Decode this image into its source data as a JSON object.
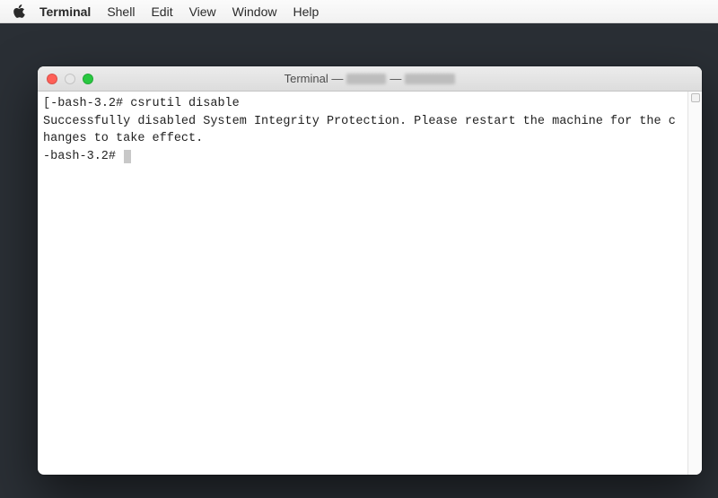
{
  "menubar": {
    "app_name": "Terminal",
    "items": [
      "Shell",
      "Edit",
      "View",
      "Window",
      "Help"
    ]
  },
  "window": {
    "title_prefix": "Terminal —",
    "traffic": {
      "close": "close",
      "minimize": "minimize",
      "zoom": "zoom"
    }
  },
  "terminal": {
    "line1_prompt_open": "[",
    "line1_prompt": "-bash-3.2#",
    "line1_cmd": "csrutil disable",
    "line2": "Successfully disabled System Integrity Protection. Please restart the machine for the changes to take effect.",
    "line3_prompt": "-bash-3.2#"
  }
}
